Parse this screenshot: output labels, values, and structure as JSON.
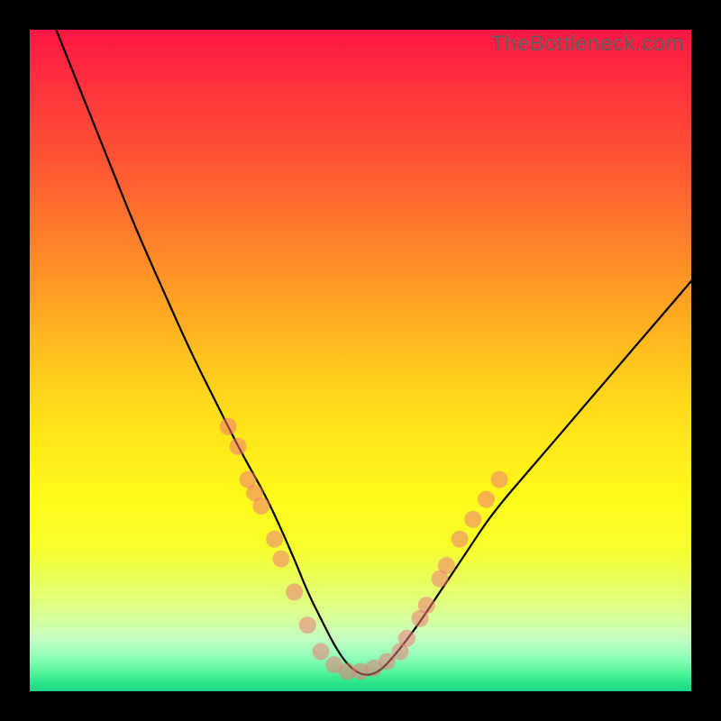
{
  "watermark": "TheBottleneck.com",
  "colors": {
    "background": "#000000",
    "gradient_top": "#ff1744",
    "gradient_mid": "#fff81a",
    "gradient_bottom": "#1fd383",
    "curve": "#000000",
    "dot_fill": "#ef7878"
  },
  "chart_data": {
    "type": "line",
    "title": "",
    "xlabel": "",
    "ylabel": "",
    "xlim": [
      0,
      100
    ],
    "ylim": [
      0,
      100
    ],
    "note": "Axis values estimated from pixel positions; chart has no tick labels.",
    "series": [
      {
        "name": "bottleneck-curve",
        "x": [
          4,
          8,
          12,
          16,
          20,
          24,
          28,
          32,
          36,
          40,
          42,
          44,
          46,
          48,
          50,
          52,
          54,
          58,
          62,
          66,
          70,
          76,
          82,
          88,
          94,
          100
        ],
        "y": [
          100,
          90,
          80,
          70,
          61,
          52,
          44,
          36,
          29,
          20,
          15,
          11,
          7,
          4,
          2.5,
          2.5,
          4,
          9,
          15,
          21,
          27,
          34,
          41,
          48,
          55,
          62
        ]
      }
    ],
    "points": [
      {
        "x": 30,
        "y": 40
      },
      {
        "x": 31.5,
        "y": 37
      },
      {
        "x": 33,
        "y": 32
      },
      {
        "x": 34,
        "y": 30
      },
      {
        "x": 35,
        "y": 28
      },
      {
        "x": 37,
        "y": 23
      },
      {
        "x": 38,
        "y": 20
      },
      {
        "x": 40,
        "y": 15
      },
      {
        "x": 42,
        "y": 10
      },
      {
        "x": 44,
        "y": 6
      },
      {
        "x": 46,
        "y": 4
      },
      {
        "x": 48,
        "y": 3
      },
      {
        "x": 50,
        "y": 3
      },
      {
        "x": 52,
        "y": 3.5
      },
      {
        "x": 54,
        "y": 4.5
      },
      {
        "x": 56,
        "y": 6
      },
      {
        "x": 57,
        "y": 8
      },
      {
        "x": 59,
        "y": 11
      },
      {
        "x": 60,
        "y": 13
      },
      {
        "x": 62,
        "y": 17
      },
      {
        "x": 63,
        "y": 19
      },
      {
        "x": 65,
        "y": 23
      },
      {
        "x": 67,
        "y": 26
      },
      {
        "x": 69,
        "y": 29
      },
      {
        "x": 71,
        "y": 32
      }
    ]
  }
}
